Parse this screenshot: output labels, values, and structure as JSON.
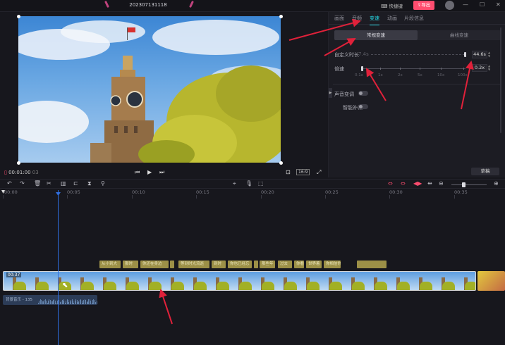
{
  "topbar": {
    "project_title": "202307131118",
    "shortcut_label": "快捷键",
    "export_label": "导出",
    "window_buttons": [
      "—",
      "☐",
      "✕"
    ]
  },
  "player": {
    "timecode_current": "00:01:00",
    "timecode_frames": "03",
    "aspect_ratio": "16:9"
  },
  "panel": {
    "tabs": [
      {
        "label": "画面",
        "active": false
      },
      {
        "label": "音频",
        "active": false
      },
      {
        "label": "变速",
        "active": true
      },
      {
        "label": "动画",
        "active": false
      },
      {
        "label": "片段信息",
        "active": false
      }
    ],
    "modes": [
      {
        "label": "常规变速",
        "active": true
      },
      {
        "label": "曲线变速",
        "active": false
      }
    ],
    "duration": {
      "label": "自定义时长",
      "hint": "7.4s",
      "value": "44.6s"
    },
    "speed": {
      "label": "倍速",
      "value": "0.2x",
      "ticks": [
        "0.1x",
        "1x",
        "2x",
        "5x",
        "10x",
        "100x"
      ]
    },
    "pitch_label": "声音变调",
    "smooth_label": "智能补帧",
    "bottom_button": "草稿"
  },
  "timeline": {
    "ruler": [
      "00:00",
      "00:05",
      "00:10",
      "00:15",
      "00:20",
      "00:25",
      "00:30",
      "00:35"
    ],
    "clip_label": "00:37",
    "captions": [
      "从小到大",
      "那时",
      "你还在身边",
      "",
      "等到时光流逝",
      "到时",
      "你也已经忘",
      "",
      "那些年",
      "过去",
      "你看着",
      "世界着",
      "你相信你我"
    ],
    "audio_label": "背景音乐 - 135"
  },
  "colors": {
    "accent": "#25d7e4",
    "export": "#ff4d6f",
    "playhead": "#2f6ee0",
    "annotation": "#e0213a"
  }
}
